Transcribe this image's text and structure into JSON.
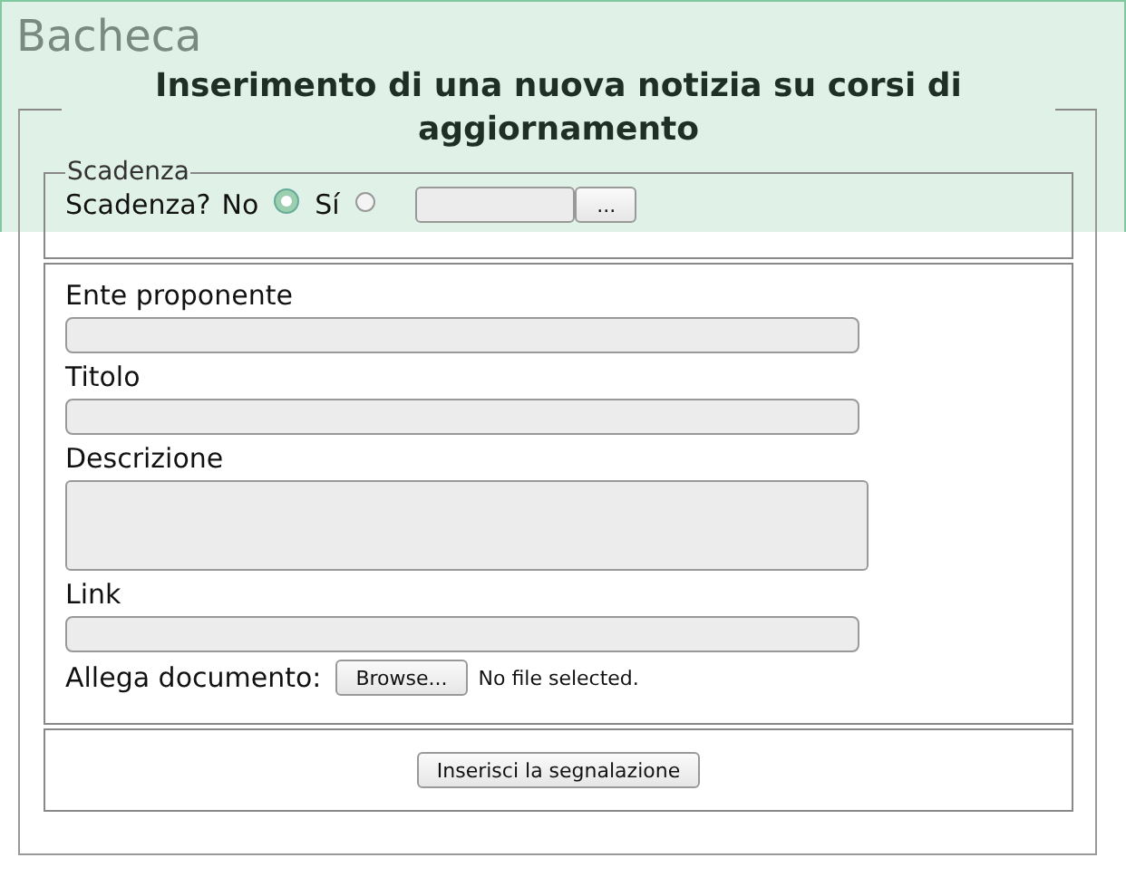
{
  "banner": {
    "title": "Bacheca"
  },
  "form": {
    "title": "Inserimento di una nuova notizia su corsi di aggiornamento",
    "deadline": {
      "legend": "Scadenza",
      "question": "Scadenza?",
      "options": [
        {
          "label": "No",
          "selected": true
        },
        {
          "label": "Sí",
          "selected": false
        }
      ],
      "picker_button": "..."
    },
    "fields": [
      {
        "label": "Ente proponente",
        "kind": "text"
      },
      {
        "label": "Titolo",
        "kind": "text"
      },
      {
        "label": "Descrizione",
        "kind": "textarea"
      },
      {
        "label": "Link",
        "kind": "text"
      }
    ],
    "attachment": {
      "label": "Allega documento:",
      "button": "Browse...",
      "status": "No file selected."
    },
    "submit": "Inserisci la segnalazione"
  }
}
